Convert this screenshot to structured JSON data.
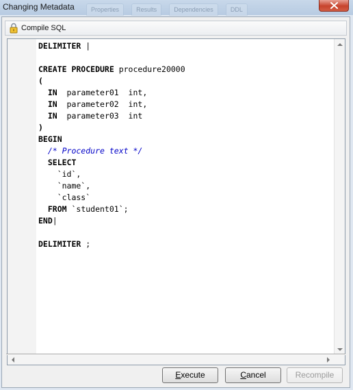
{
  "window": {
    "title": "Changing Metadata",
    "background_tabs": [
      "Properties",
      "Results",
      "Dependencies",
      "DDL"
    ]
  },
  "toolbar": {
    "compile_label": "Compile SQL",
    "compile_icon": "lock-icon"
  },
  "editor": {
    "lines": [
      {
        "kw": "DELIMITER",
        "rest": " |"
      },
      {
        "kw": "",
        "rest": ""
      },
      {
        "kw": "CREATE PROCEDURE",
        "rest": " procedure20000"
      },
      {
        "kw": "(",
        "rest": ""
      },
      {
        "kw": "  IN",
        "rest": "  parameter01  int,"
      },
      {
        "kw": "  IN",
        "rest": "  parameter02  int,"
      },
      {
        "kw": "  IN",
        "rest": "  parameter03  int"
      },
      {
        "kw": ")",
        "rest": ""
      },
      {
        "kw": "BEGIN",
        "rest": ""
      },
      {
        "comment": "  /* Procedure text */"
      },
      {
        "kw": "  SELECT",
        "rest": ""
      },
      {
        "kw": "",
        "rest": "    `id`,"
      },
      {
        "kw": "",
        "rest": "    `name`,"
      },
      {
        "kw": "",
        "rest": "    `class`"
      },
      {
        "kw": "  FROM",
        "rest": " `student01`;"
      },
      {
        "kw": "END",
        "rest": "|"
      },
      {
        "kw": "",
        "rest": ""
      },
      {
        "kw": "DELIMITER",
        "rest": " ;"
      }
    ]
  },
  "buttons": {
    "execute": {
      "pre": "",
      "accel": "E",
      "post": "xecute"
    },
    "cancel": {
      "pre": "",
      "accel": "C",
      "post": "ancel"
    },
    "recompile": {
      "label": "Recompile",
      "enabled": false
    }
  },
  "colors": {
    "comment": "#0000c8",
    "titlebar": "#b7cbe2",
    "close_button": "#c7432d"
  }
}
